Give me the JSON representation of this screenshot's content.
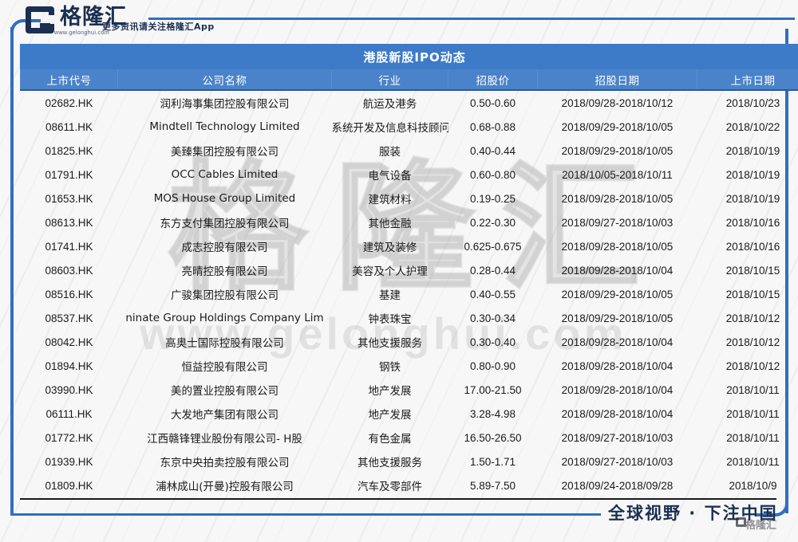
{
  "header": {
    "logo_cn": "格隆汇",
    "logo_url": "www.gelonghui.com",
    "tagline": "更多资讯请关注格隆汇App"
  },
  "table": {
    "title": "港股新股IPO动态",
    "columns": [
      "上市代号",
      "公司名称",
      "行业",
      "招股价",
      "招股日期",
      "上市日期"
    ],
    "rows": [
      {
        "code": "02682.HK",
        "name": "润利海事集团控股有限公司",
        "industry": "航运及港务",
        "price": "0.50-0.60",
        "offer_period": "2018/09/28-2018/10/12",
        "listing_date": "2018/10/23"
      },
      {
        "code": "08611.HK",
        "name": "Mindtell Technology Limited",
        "industry": "系统开发及信息科技顾问",
        "price": "0.68-0.88",
        "offer_period": "2018/09/29-2018/10/05",
        "listing_date": "2018/10/22"
      },
      {
        "code": "01825.HK",
        "name": "美臻集团控股有限公司",
        "industry": "服装",
        "price": "0.40-0.44",
        "offer_period": "2018/09/29-2018/10/05",
        "listing_date": "2018/10/19"
      },
      {
        "code": "01791.HK",
        "name": "OCC Cables Limited",
        "industry": "电气设备",
        "price": "0.60-0.80",
        "offer_period": "2018/10/05-2018/10/11",
        "listing_date": "2018/10/19"
      },
      {
        "code": "01653.HK",
        "name": "MOS House Group Limited",
        "industry": "建筑材料",
        "price": "0.19-0.25",
        "offer_period": "2018/09/28-2018/10/05",
        "listing_date": "2018/10/19"
      },
      {
        "code": "08613.HK",
        "name": "东方支付集团控股有限公司",
        "industry": "其他金融",
        "price": "0.22-0.30",
        "offer_period": "2018/09/27-2018/10/03",
        "listing_date": "2018/10/16"
      },
      {
        "code": "01741.HK",
        "name": "成志控股有限公司",
        "industry": "建筑及装修",
        "price": "0.625-0.675",
        "offer_period": "2018/09/28-2018/10/05",
        "listing_date": "2018/10/16"
      },
      {
        "code": "08603.HK",
        "name": "亮晴控股有限公司",
        "industry": "美容及个人护理",
        "price": "0.28-0.44",
        "offer_period": "2018/09/28-2018/10/04",
        "listing_date": "2018/10/15"
      },
      {
        "code": "08516.HK",
        "name": "广骏集团控股有限公司",
        "industry": "基建",
        "price": "0.40-0.55",
        "offer_period": "2018/09/29-2018/10/05",
        "listing_date": "2018/10/15"
      },
      {
        "code": "08537.HK",
        "name": "ninate Group Holdings Company Lim",
        "industry": "钟表珠宝",
        "price": "0.30-0.34",
        "offer_period": "2018/09/29-2018/10/05",
        "listing_date": "2018/10/12"
      },
      {
        "code": "08042.HK",
        "name": "高奥士国际控股有限公司",
        "industry": "其他支援服务",
        "price": "0.30-0.40",
        "offer_period": "2018/09/28-2018/10/04",
        "listing_date": "2018/10/12"
      },
      {
        "code": "01894.HK",
        "name": "恒益控股有限公司",
        "industry": "钢铁",
        "price": "0.80-0.90",
        "offer_period": "2018/09/28-2018/10/04",
        "listing_date": "2018/10/12"
      },
      {
        "code": "03990.HK",
        "name": "美的置业控股有限公司",
        "industry": "地产发展",
        "price": "17.00-21.50",
        "offer_period": "2018/09/28-2018/10/04",
        "listing_date": "2018/10/11"
      },
      {
        "code": "06111.HK",
        "name": "大发地产集团有限公司",
        "industry": "地产发展",
        "price": "3.28-4.98",
        "offer_period": "2018/09/28-2018/10/04",
        "listing_date": "2018/10/11"
      },
      {
        "code": "01772.HK",
        "name": "江西赣锋锂业股份有限公司- H股",
        "industry": "有色金属",
        "price": "16.50-26.50",
        "offer_period": "2018/09/27-2018/10/03",
        "listing_date": "2018/10/11"
      },
      {
        "code": "01939.HK",
        "name": "东京中央拍卖控股有限公司",
        "industry": "其他支援服务",
        "price": "1.50-1.71",
        "offer_period": "2018/09/27-2018/10/03",
        "listing_date": "2018/10/11"
      },
      {
        "code": "01809.HK",
        "name": "浦林成山(开曼)控股有限公司",
        "industry": "汽车及零部件",
        "price": "5.89-7.50",
        "offer_period": "2018/09/24-2018/09/28",
        "listing_date": "2018/10/9"
      }
    ]
  },
  "watermark": {
    "big_text": "格隆汇",
    "url_text": "www.gelonghui.com"
  },
  "footer": {
    "slogan": "全球视野 · 下注中国",
    "logo_cn": "格隆汇"
  },
  "colors": {
    "accent_blue": "#2f6fc0",
    "title_blue": "#3d7bc8",
    "header_blue": "#4a83c9",
    "dark_navy": "#1b2f52"
  }
}
